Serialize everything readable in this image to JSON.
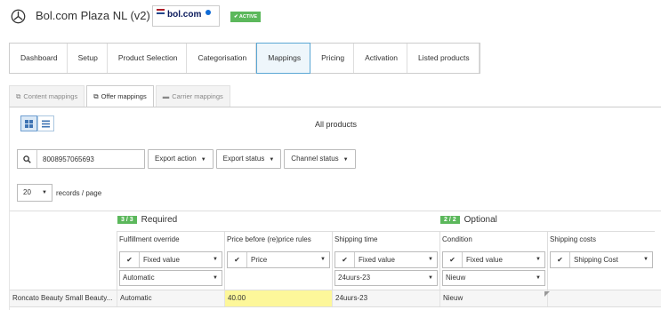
{
  "app": {
    "title": "Bol.com Plaza NL (v2)",
    "logo_text": "bol.com",
    "status_badge": "✔ ACTIVE"
  },
  "wizard": {
    "steps": [
      "Dashboard",
      "Setup",
      "Product Selection",
      "Categorisation",
      "Mappings",
      "Pricing",
      "Activation",
      "Listed products"
    ],
    "active": "Mappings"
  },
  "tabs": [
    {
      "label": "Content mappings",
      "active": false
    },
    {
      "label": "Offer mappings",
      "active": true
    },
    {
      "label": "Carrier mappings",
      "active": false
    }
  ],
  "panel": {
    "heading": "All products"
  },
  "search": {
    "value": "8008957065693",
    "placeholder": ""
  },
  "dropdowns": {
    "export_action": "Export action",
    "export_status": "Export status",
    "channel_status": "Channel status"
  },
  "records": {
    "per_page": "20",
    "label": "records / page"
  },
  "groups": {
    "required": {
      "count": "3 / 3",
      "label": "Required"
    },
    "optional": {
      "count": "2 / 2",
      "label": "Optional"
    }
  },
  "columns": [
    {
      "label": "Fulfillment override",
      "select": "Fixed value",
      "sub": "Automatic"
    },
    {
      "label": "Price before (re)price rules",
      "select": "Price",
      "sub": ""
    },
    {
      "label": "Shipping time",
      "select": "Fixed value",
      "sub": "24uurs-23"
    },
    {
      "label": "Condition",
      "select": "Fixed value",
      "sub": "Nieuw"
    },
    {
      "label": "Shipping costs",
      "select": "Shipping Cost",
      "sub": ""
    }
  ],
  "rows": [
    {
      "product": "Roncato Beauty Small Beauty...",
      "fulfillment": "Automatic",
      "price": "40.00",
      "shipping_time": "24uurs-23",
      "condition": "Nieuw",
      "shipping_cost": ""
    }
  ],
  "colors": {
    "active_badge": "#5cb85c",
    "highlight": "#fdf79a",
    "accent": "#5aa7d4"
  }
}
